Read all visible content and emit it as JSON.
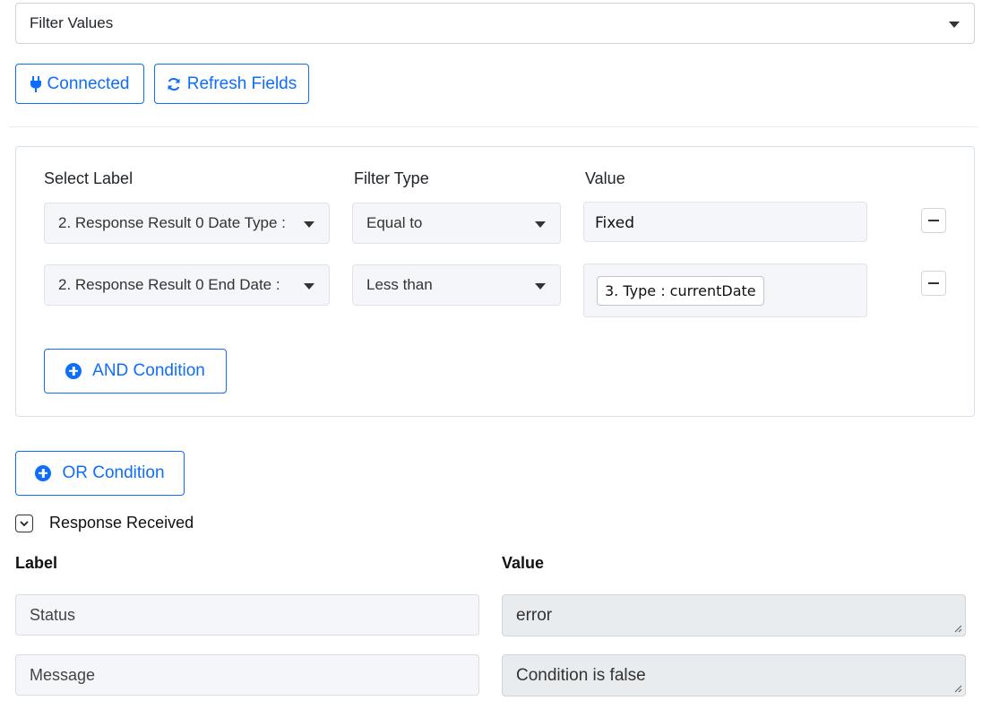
{
  "filter_select": {
    "value": "Filter Values"
  },
  "toolbar": {
    "connected_label": "Connected",
    "refresh_label": "Refresh Fields"
  },
  "filter_panel": {
    "columns": {
      "select_label": "Select Label",
      "filter_type": "Filter Type",
      "value": "Value"
    },
    "conditions": [
      {
        "label": "2. Response Result 0 Date Type :",
        "filter_type": "Equal to",
        "value": "Fixed"
      },
      {
        "label": "2. Response Result 0 End Date :",
        "filter_type": "Less than",
        "value_chip": "3. Type : currentDate"
      }
    ],
    "and_condition_label": "AND Condition"
  },
  "or_condition_label": "OR Condition",
  "response": {
    "title": "Response Received",
    "label_header": "Label",
    "value_header": "Value",
    "rows": [
      {
        "label": "Status",
        "value": "error"
      },
      {
        "label": "Message",
        "value": "Condition is false"
      }
    ]
  },
  "colors": {
    "accent": "#0d6efd",
    "field_bg": "#f4f6f9",
    "readonly_bg": "#e9ecef"
  }
}
